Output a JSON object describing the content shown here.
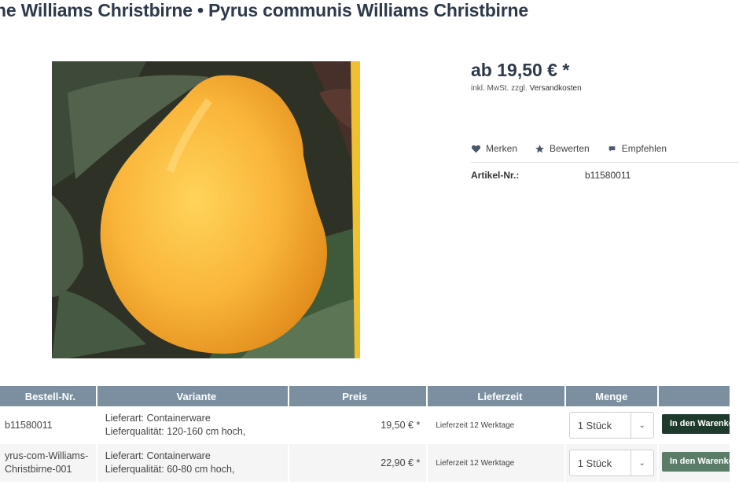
{
  "product": {
    "title": "ne Williams Christbirne • Pyrus communis Williams Christbirne",
    "price": "ab 19,50 € *",
    "price_note_prefix": "inkl. MwSt. zzgl.",
    "price_note_link": "Versandkosten",
    "actions": [
      {
        "label": "Merken",
        "icon": "heart-icon"
      },
      {
        "label": "Bewerten",
        "icon": "star-icon"
      },
      {
        "label": "Empfehlen",
        "icon": "comment-icon"
      }
    ],
    "artnr_label": "Artikel-Nr.:",
    "artnr_value": "b11580011"
  },
  "table": {
    "headers": [
      "Bestell-Nr.",
      "Variante",
      "Preis",
      "Lieferzeit",
      "Menge",
      ""
    ],
    "rows": [
      {
        "nr_line1": "b11580011",
        "nr_line2": "",
        "var_line1": "Lieferart: Containerware",
        "var_line2": "Lieferqualität: 120-160 cm hoch,",
        "price": "19,50 € *",
        "lieferzeit": "Lieferzeit 12 Werktage",
        "qty": "1 Stück",
        "button": "In den Warenkorb",
        "button_color": "#1e3a2c"
      },
      {
        "nr_line1": "yrus-com-Williams-",
        "nr_line2": "Christbirne-001",
        "var_line1": "Lieferart: Containerware",
        "var_line2": "Lieferqualität: 60-80 cm hoch,",
        "price": "22,90 € *",
        "lieferzeit": "Lieferzeit 12 Werktage",
        "qty": "1 Stück",
        "button": "In den Warenkorb",
        "button_color": "#5b7d68"
      }
    ]
  },
  "colors": {
    "header_bg": "#7b8fa0",
    "title_color": "#2d3a4b"
  }
}
